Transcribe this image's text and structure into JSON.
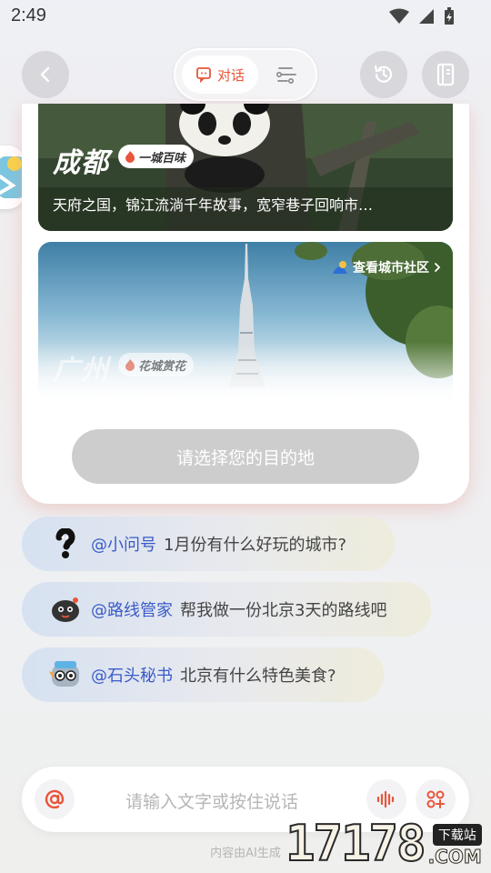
{
  "status_bar": {
    "time": "2:49"
  },
  "top_bar": {
    "chat_label": "对话"
  },
  "cities": [
    {
      "name": "成都",
      "tag": "一城百味",
      "description": "天府之国，锦江流淌千年故事，宽窄巷子回响市…"
    },
    {
      "name": "广州",
      "tag": "花城赏花",
      "community_link": "查看城市社区"
    }
  ],
  "destination_button": "请选择您的目的地",
  "suggestions": [
    {
      "mention": "@小问号",
      "question": "1月份有什么好玩的城市?"
    },
    {
      "mention": "@路线管家",
      "question": "帮我做一份北京3天的路线吧"
    },
    {
      "mention": "@石头秘书",
      "question": "北京有什么特色美食?"
    }
  ],
  "input": {
    "placeholder": "请输入文字或按住说话"
  },
  "footer_note": "内容由AI生成",
  "watermark": {
    "number": "17178",
    "tag": "下载站",
    "domain": ".COM"
  },
  "colors": {
    "accent": "#e8553a",
    "mention": "#3a5bc8",
    "button_disabled": "#cdcdcd"
  },
  "icons": [
    "back-icon",
    "chat-icon",
    "route-icon",
    "history-icon",
    "notebook-icon",
    "flame-icon",
    "at-icon",
    "voice-icon",
    "apps-icon"
  ]
}
